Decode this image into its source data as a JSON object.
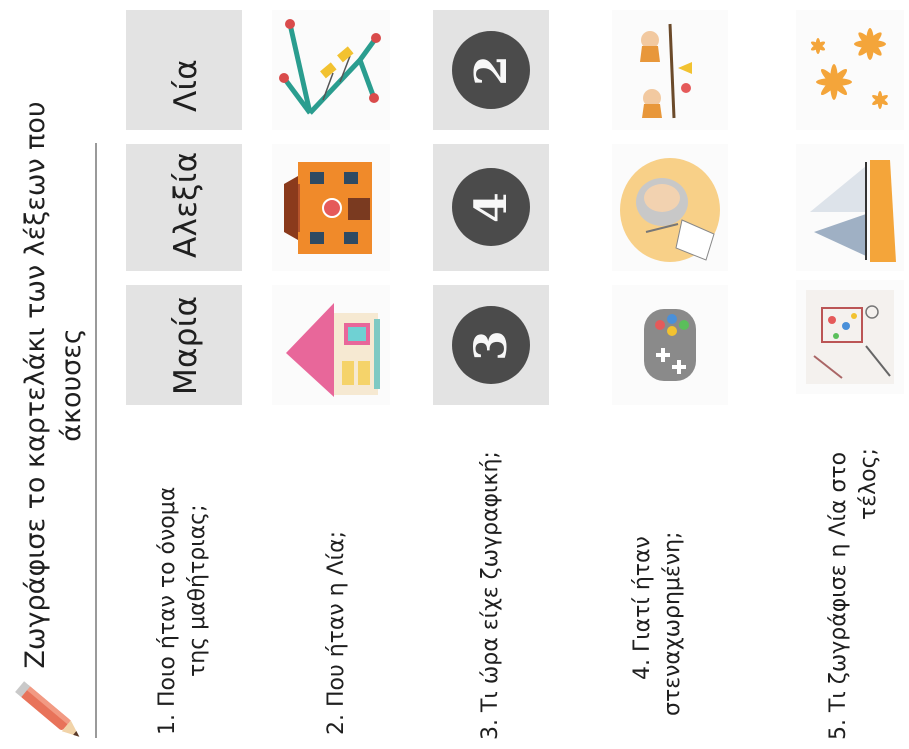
{
  "title": {
    "line1": "Ζωγράφισε το καρτελάκι των λέξεων που",
    "line2": "άκουσες"
  },
  "names": [
    "Λία",
    "Αλεξία",
    "Μαρία"
  ],
  "questions": [
    {
      "line1": "1.  Ποιο ήταν το όνομα",
      "line2": "της μαθήτριας;"
    },
    {
      "line1": "2. Που ήταν η Λία;",
      "line2": ""
    },
    {
      "line1": "3. Τι ώρα είχε ζωγραφική;",
      "line2": ""
    },
    {
      "line1": "4. Γιατί ήταν",
      "line2": "στεναχωρημένη;"
    },
    {
      "line1": "5. Τι ζωγράφισε η Λία στο",
      "line2": "τέλος;"
    }
  ],
  "numbers": [
    "2",
    "4",
    "3"
  ],
  "icons": {
    "pencil": "pencil-icon",
    "row2": [
      "swing-icon",
      "school-icon",
      "house-icon"
    ],
    "row4": [
      "children-seesaw-icon",
      "sad-girl-icon",
      "game-controller-icon"
    ],
    "row5": [
      "flowers-icon",
      "sailboat-icon",
      "kids-drawing-icon"
    ]
  },
  "colors": {
    "cell_gray": "#e3e3e3",
    "number_circle": "#4b4b4b",
    "swing_frame": "#2a9d8f",
    "flower_orange": "#f4a53a"
  }
}
